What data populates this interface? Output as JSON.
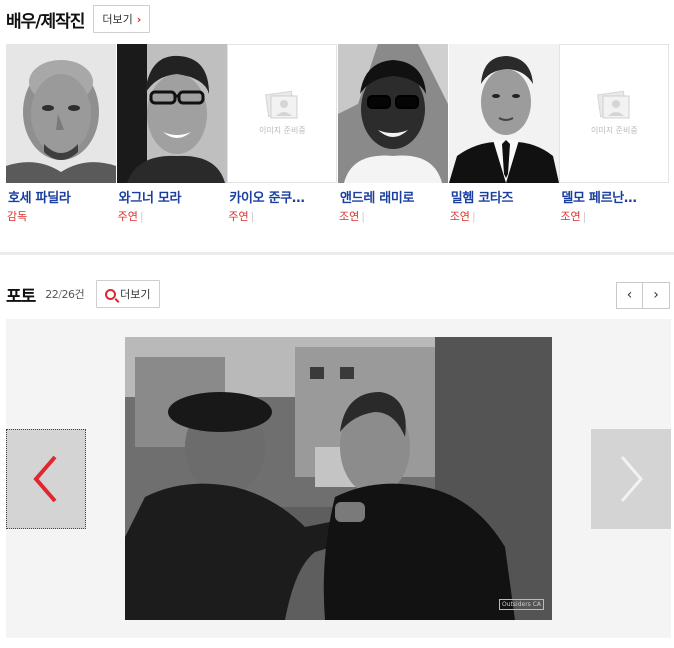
{
  "cast_section": {
    "title": "배우/제작진",
    "more_label": "더보기",
    "items": [
      {
        "name": "호세 파딜라",
        "role": "감독",
        "has_photo": true
      },
      {
        "name": "와그너 모라",
        "role": "주연",
        "has_photo": true
      },
      {
        "name": "카이오 준쿠…",
        "role": "주연",
        "has_photo": false
      },
      {
        "name": "앤드레 래미로",
        "role": "조연",
        "has_photo": true
      },
      {
        "name": "밀헴 코타즈",
        "role": "조연",
        "has_photo": true
      },
      {
        "name": "델모 페르난…",
        "role": "조연",
        "has_photo": false
      }
    ],
    "placeholder_text": "이미지 준비중",
    "role_separator": "|"
  },
  "photo_section": {
    "title": "포토",
    "current": "22",
    "separator": "/",
    "total": "26건",
    "more_label": "더보기",
    "prev_label": "‹",
    "next_label": "›",
    "watermark": "Outsiders CA"
  },
  "colors": {
    "accent_red": "#e0262f",
    "name_blue": "#1a3fa0",
    "viewer_bg": "#f4f4f4"
  },
  "icons": [
    "chevron-right-icon",
    "zoom-icon",
    "chevron-left-icon",
    "image-placeholder-icon"
  ]
}
